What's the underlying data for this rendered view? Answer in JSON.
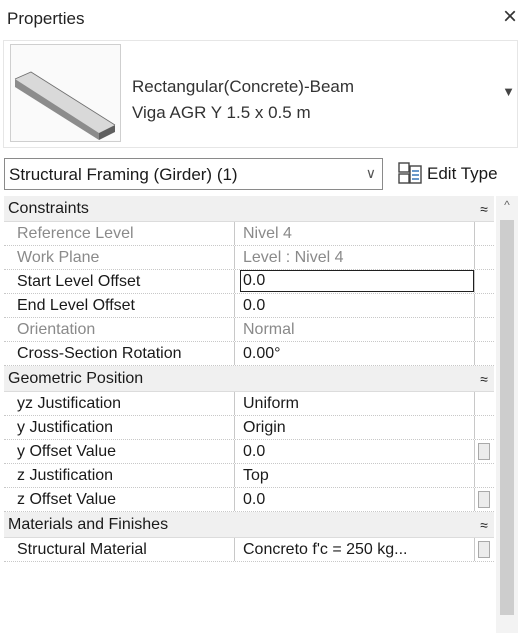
{
  "window": {
    "title": "Properties",
    "close_glyph": "×"
  },
  "type_selector": {
    "family": "Rectangular(Concrete)-Beam",
    "type": "Viga AGR Y 1.5 x 0.5 m",
    "dropdown_glyph": "▼",
    "preview_icon": "beam-preview-icon"
  },
  "instance": {
    "label": "Structural Framing (Girder) (1)",
    "chevron": "∨",
    "edit_type_label": "Edit Type",
    "edit_type_icon": "edit-type-icon"
  },
  "groups": {
    "constraints": "Constraints",
    "geometric": "Geometric Position",
    "materials": "Materials and Finishes",
    "collapse_glyph": "≈"
  },
  "rows": {
    "reference_level": {
      "name": "Reference Level",
      "value": "Nivel 4"
    },
    "work_plane": {
      "name": "Work Plane",
      "value": "Level : Nivel 4"
    },
    "start_level_offset": {
      "name": "Start Level Offset",
      "value": "0.0"
    },
    "end_level_offset": {
      "name": "End Level Offset",
      "value": "0.0"
    },
    "orientation": {
      "name": "Orientation",
      "value": "Normal"
    },
    "cross_section_rotation": {
      "name": "Cross-Section Rotation",
      "value": "0.00°"
    },
    "yz_justification": {
      "name": "yz Justification",
      "value": "Uniform"
    },
    "y_justification": {
      "name": "y Justification",
      "value": "Origin"
    },
    "y_offset_value": {
      "name": "y Offset Value",
      "value": "0.0"
    },
    "z_justification": {
      "name": "z Justification",
      "value": "Top"
    },
    "z_offset_value": {
      "name": "z Offset Value",
      "value": "0.0"
    },
    "structural_material": {
      "name": "Structural Material",
      "value": "Concreto f'c = 250 kg..."
    }
  },
  "scrollbar": {
    "up_glyph": "^"
  },
  "colors": {
    "group_bg": "#f0f0f0",
    "readonly_text": "#8a8a8a",
    "border": "#c8c8c8"
  }
}
